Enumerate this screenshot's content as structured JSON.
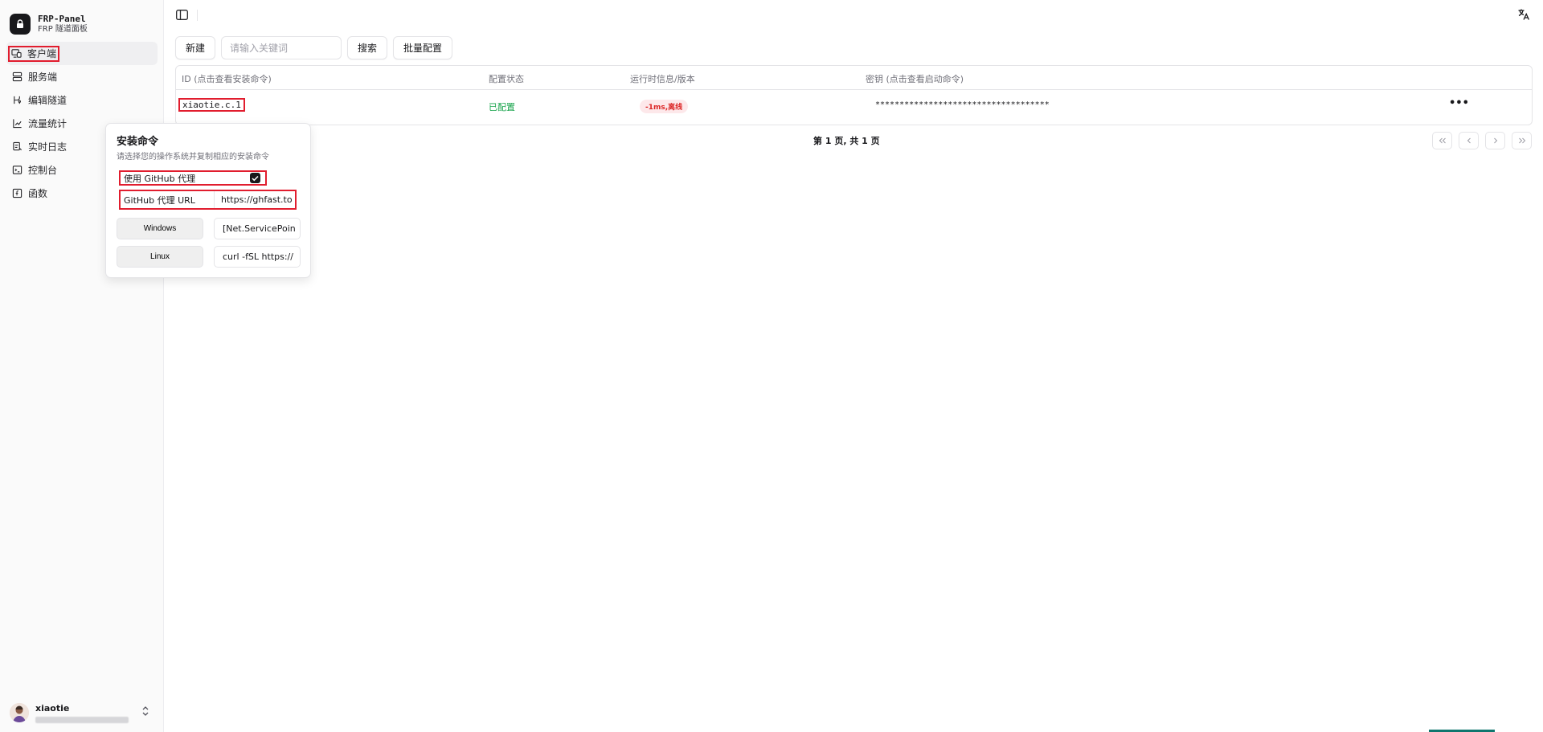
{
  "brand": {
    "name": "FRP-Panel",
    "subtitle": "FRP 隧道面板"
  },
  "sidebar": {
    "items": [
      {
        "label": "客户端",
        "icon": "client-icon",
        "active": true
      },
      {
        "label": "服务端",
        "icon": "server-icon"
      },
      {
        "label": "编辑隧道",
        "icon": "tunnel-icon"
      },
      {
        "label": "流量统计",
        "icon": "chart-icon"
      },
      {
        "label": "实时日志",
        "icon": "log-icon"
      },
      {
        "label": "控制台",
        "icon": "terminal-icon"
      },
      {
        "label": "函数",
        "icon": "function-icon"
      }
    ]
  },
  "user": {
    "name": "xiaotie"
  },
  "toolbar": {
    "new_label": "新建",
    "search_placeholder": "请输入关键词",
    "search_label": "搜索",
    "batch_label": "批量配置"
  },
  "table": {
    "headers": {
      "id": "ID (点击查看安装命令)",
      "config_status": "配置状态",
      "runtime": "运行时信息/版本",
      "secret": "密钥 (点击查看启动命令)"
    },
    "rows": [
      {
        "id": "xiaotie.c.1",
        "config_status": "已配置",
        "runtime": "-1ms,离线",
        "secret": "************************************",
        "actions": "•••"
      }
    ]
  },
  "pagination": {
    "text": "第 1 页, 共 1 页"
  },
  "popover": {
    "title": "安装命令",
    "description": "请选择您的操作系统并复制相应的安装命令",
    "proxy_label": "使用 GitHub 代理",
    "proxy_checked": true,
    "url_label": "GitHub 代理 URL",
    "url_value": "https://ghfast.to",
    "windows_label": "Windows",
    "windows_cmd": "[Net.ServicePoin",
    "linux_label": "Linux",
    "linux_cmd": "curl -fSL https://"
  },
  "colors": {
    "accent": "#18181b",
    "highlight": "#e11d2e",
    "success": "#16a34a",
    "danger": "#dc2626"
  }
}
